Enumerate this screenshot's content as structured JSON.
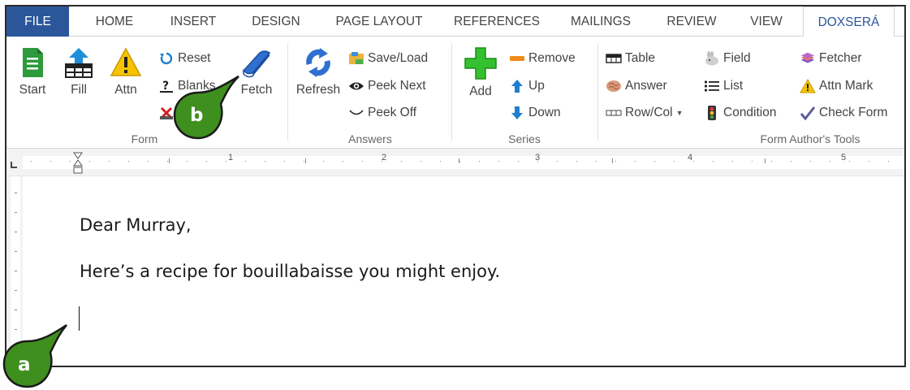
{
  "tabs": {
    "file": "FILE",
    "home": "HOME",
    "insert": "INSERT",
    "design": "DESIGN",
    "page_layout": "PAGE LAYOUT",
    "references": "REFERENCES",
    "mailings": "MAILINGS",
    "review": "REVIEW",
    "view": "VIEW",
    "doxsera": "DOXSERÁ"
  },
  "ribbon": {
    "form": {
      "group_label": "Form",
      "start": "Start",
      "fill": "Fill",
      "attn": "Attn",
      "reset": "Reset",
      "blanks": "Blanks",
      "fetch": "Fetch"
    },
    "answers": {
      "group_label": "Answers",
      "refresh": "Refresh",
      "save_load": "Save/Load",
      "peek_next": "Peek Next",
      "peek_off": "Peek Off"
    },
    "series": {
      "group_label": "Series",
      "add": "Add",
      "remove": "Remove",
      "up": "Up",
      "down": "Down"
    },
    "authors_tools": {
      "group_label": "Form Author's Tools",
      "table": "Table",
      "answer": "Answer",
      "row_col": "Row/Col",
      "field": "Field",
      "list": "List",
      "condition": "Condition",
      "fetcher": "Fetcher",
      "attn_mark": "Attn Mark",
      "check_form": "Check Form"
    }
  },
  "ruler": {
    "numbers": [
      "1",
      "2",
      "3",
      "4",
      "5"
    ]
  },
  "document": {
    "line1": "Dear Murray,",
    "line2": "Here’s a recipe for bouillabaisse you might enjoy."
  },
  "callouts": {
    "a": "a",
    "b": "b"
  },
  "colors": {
    "file_tab": "#2b579a",
    "accent_text": "#2b579a",
    "callout_fill": "#3f8f1f",
    "callout_border": "#1a1a1a"
  }
}
